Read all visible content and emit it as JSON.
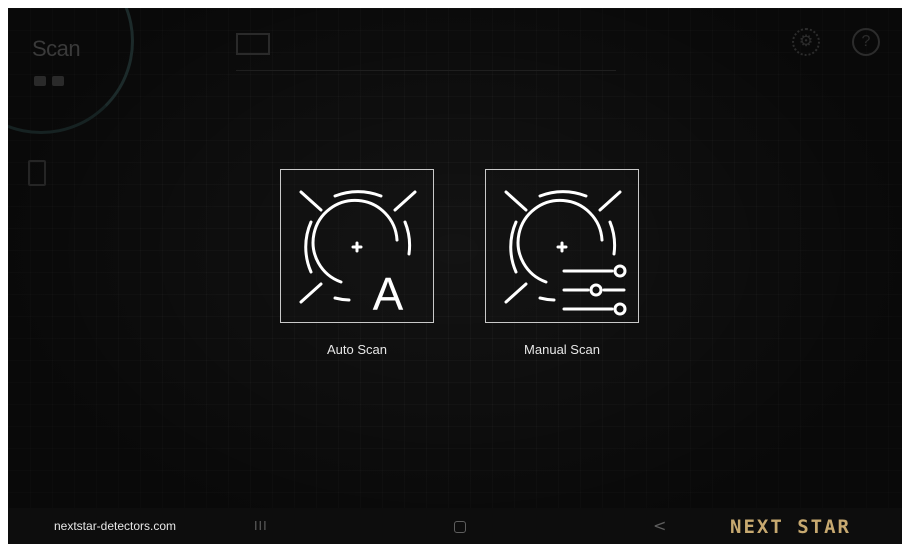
{
  "background_app": {
    "title": "Scan"
  },
  "scan_modes": [
    {
      "label": "Auto Scan",
      "icon": "auto-scan-icon",
      "icon_letter": "A"
    },
    {
      "label": "Manual Scan",
      "icon": "manual-scan-icon"
    }
  ],
  "footer": {
    "watermark": "nextstar-detectors.com",
    "brand": "NEXT STAR"
  },
  "nav": {
    "recents": "III",
    "back": "<"
  },
  "colors": {
    "background": "#131313",
    "icon_stroke": "#ffffff",
    "tile_border": "#c9c9c9",
    "brand": "#c7a970"
  }
}
